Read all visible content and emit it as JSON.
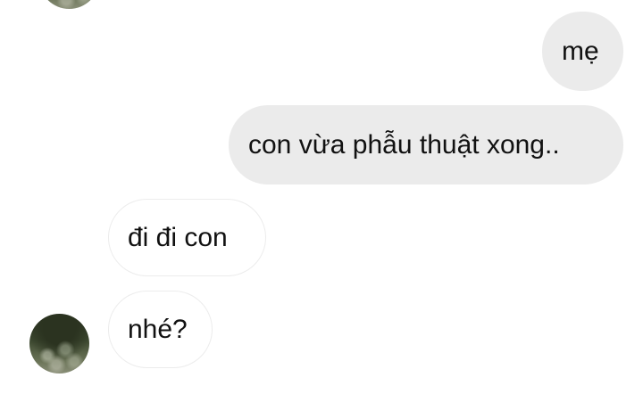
{
  "messages": [
    {
      "id": "m1",
      "direction": "outgoing",
      "text": "mẹ"
    },
    {
      "id": "m2",
      "direction": "outgoing",
      "text": "con vừa phẫu thuật xong.."
    },
    {
      "id": "m3",
      "direction": "incoming",
      "text": "đi đi con"
    },
    {
      "id": "m4",
      "direction": "incoming",
      "text": "nhé?"
    }
  ],
  "colors": {
    "outgoing_bubble": "#ebebeb",
    "incoming_bubble": "#ffffff",
    "incoming_border": "#ececec",
    "text": "#111111",
    "background": "#ffffff"
  },
  "icons": {
    "avatar": "contact-avatar-photo"
  }
}
